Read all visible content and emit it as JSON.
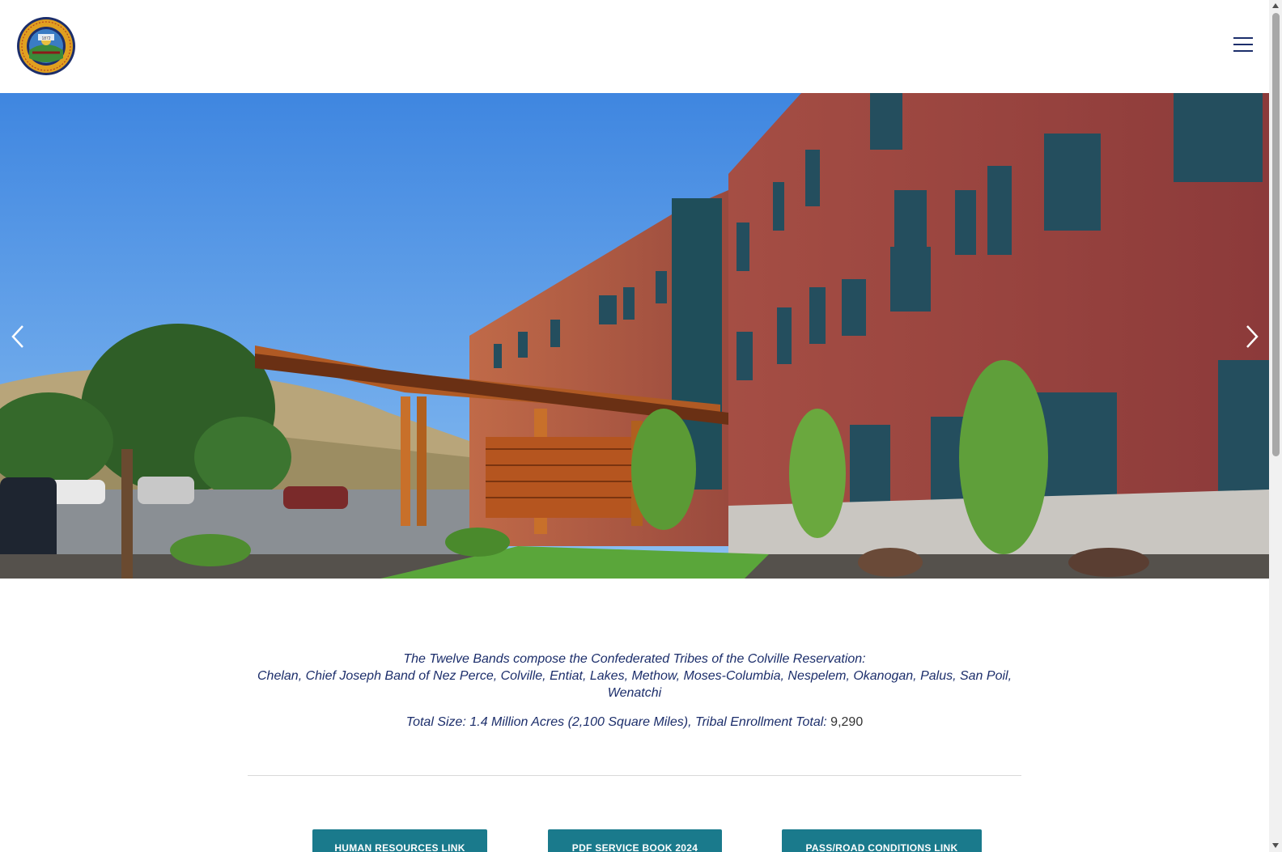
{
  "header": {
    "logo_icon": "tribal-seal-logo",
    "seal_text": "CONFEDERATED TRIBES OF THE COLVILLE RESERVATION",
    "seal_year": "1872",
    "menu_icon": "hamburger-menu-icon"
  },
  "hero": {
    "image_subject": "tribal-government-building-photo",
    "prev_icon": "chevron-left-icon",
    "next_icon": "chevron-right-icon"
  },
  "intro": {
    "line1": "The Twelve Bands compose the Confederated Tribes of the Colville Reservation:",
    "line2": "Chelan, Chief Joseph Band of Nez Perce, Colville, Entiat, Lakes, Methow, Moses-Columbia, Nespelem, Okanogan, Palus, San Poil, Wenatchi",
    "size_label": "Total Size: 1.4 Million Acres (2,100 Square Miles), Tribal Enrollment Total:",
    "enrollment_total": "9,290"
  },
  "buttons": {
    "hr": "HUMAN RESOURCES LINK",
    "pdf": "PDF SERVICE BOOK 2024",
    "pass": "PASS/ROAD CONDITIONS LINK"
  },
  "colors": {
    "brand_navy": "#1c2e6b",
    "button_teal": "#1a7a8c"
  }
}
